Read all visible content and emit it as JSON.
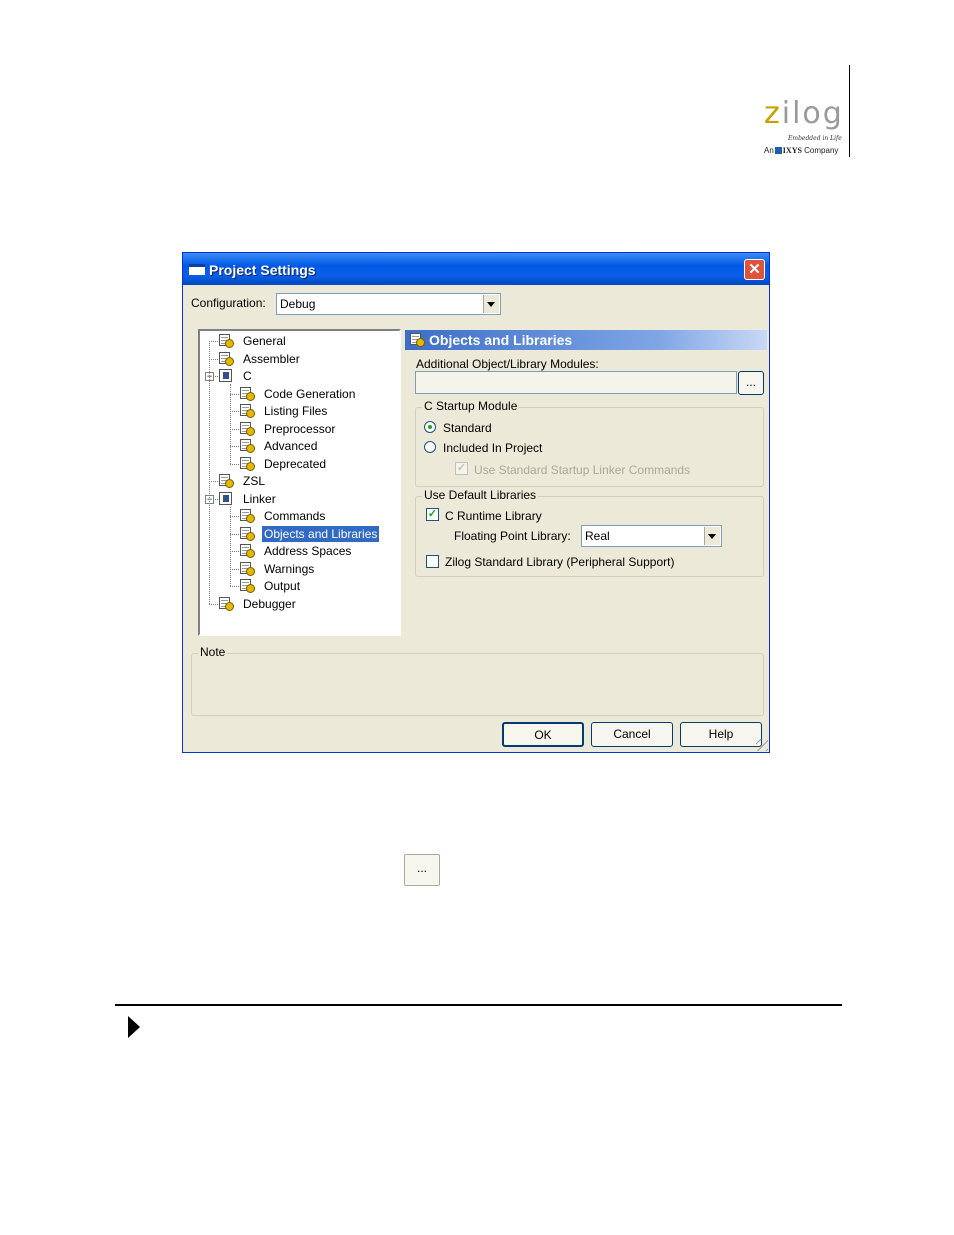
{
  "logo": {
    "word_z": "z",
    "word_rest": "ilog",
    "tagline": "Embedded in Life",
    "company_prefix": "An",
    "company_name": "IXYS",
    "company_suffix": "Company"
  },
  "dialog": {
    "title": "Project Settings",
    "close_glyph": "✕",
    "configuration_label": "Configuration:",
    "configuration_value": "Debug",
    "tree": [
      {
        "label": "General",
        "icon": "settings-page-icon"
      },
      {
        "label": "Assembler",
        "icon": "settings-page-icon"
      },
      {
        "label": "C",
        "icon": "folder-icon",
        "expanded": true
      },
      {
        "label": "Code Generation",
        "icon": "settings-page-icon"
      },
      {
        "label": "Listing Files",
        "icon": "settings-page-icon"
      },
      {
        "label": "Preprocessor",
        "icon": "settings-page-icon"
      },
      {
        "label": "Advanced",
        "icon": "settings-page-icon"
      },
      {
        "label": "Deprecated",
        "icon": "settings-page-icon"
      },
      {
        "label": "ZSL",
        "icon": "settings-page-icon"
      },
      {
        "label": "Linker",
        "icon": "folder-icon",
        "expanded": true
      },
      {
        "label": "Commands",
        "icon": "settings-page-icon"
      },
      {
        "label": "Objects and Libraries",
        "icon": "settings-page-icon",
        "selected": true
      },
      {
        "label": "Address Spaces",
        "icon": "settings-page-icon"
      },
      {
        "label": "Warnings",
        "icon": "settings-page-icon"
      },
      {
        "label": "Output",
        "icon": "settings-page-icon"
      },
      {
        "label": "Debugger",
        "icon": "settings-page-icon"
      }
    ],
    "expander_glyph": "−",
    "panel_title": "Objects and Libraries",
    "additional_modules_label": "Additional Object/Library Modules:",
    "additional_modules_value": "",
    "browse_label": "...",
    "startup_group": {
      "title": "C Startup Module",
      "standard_label": "Standard",
      "standard_selected": true,
      "included_label": "Included In Project",
      "included_selected": false,
      "use_standard_linker_label": "Use Standard Startup Linker Commands",
      "use_standard_linker_checked": true
    },
    "libraries_group": {
      "title": "Use Default Libraries",
      "c_runtime_label": "C Runtime Library",
      "c_runtime_checked": true,
      "floating_point_label": "Floating Point Library:",
      "floating_point_value": "Real",
      "zilog_std_label": "Zilog Standard Library (Peripheral Support)",
      "zilog_std_checked": false
    },
    "note_label": "Note",
    "ok_label": "OK",
    "cancel_label": "Cancel",
    "help_label": "Help",
    "check_glyph": "✓"
  },
  "page": {
    "browse_button_label": "..."
  }
}
